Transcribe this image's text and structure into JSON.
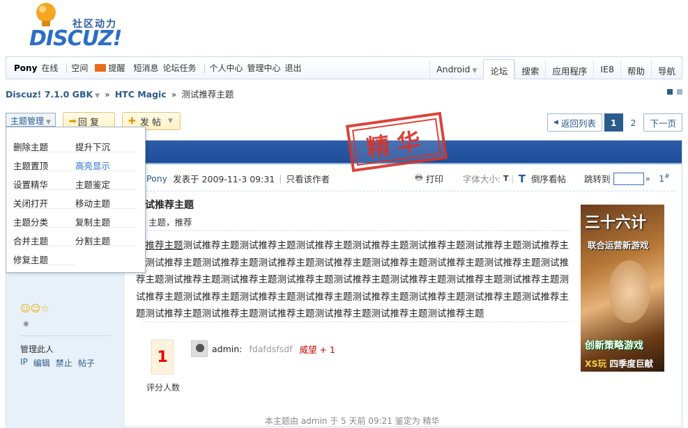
{
  "logo": {
    "cn": "社区动力",
    "en": "DISCUZ!"
  },
  "topbar": {
    "user": "Pony",
    "online": "在线",
    "left_links": [
      "空间",
      "提醒",
      "短消息",
      "论坛任务"
    ],
    "left_links2": [
      "个人中心",
      "管理中心",
      "退出"
    ],
    "right_tabs": [
      "Android",
      "论坛",
      "搜索",
      "应用程序",
      "IE8",
      "帮助",
      "导航"
    ]
  },
  "breadcrumb": {
    "home": "Discuz! 7.1.0 GBK",
    "forum": "HTC Magic",
    "sep": "»",
    "current": "测试推荐主题"
  },
  "actions": {
    "manage": "主题管理",
    "reply": "回 复",
    "post": "发 帖"
  },
  "pager": {
    "back": "返回列表",
    "pages": [
      "1",
      "2"
    ],
    "next": "下一页"
  },
  "menu": {
    "items": [
      "删除主题",
      "提升下沉",
      "主题置顶",
      "高亮显示",
      "设置精华",
      "主题鉴定",
      "关闭打开",
      "移动主题",
      "主题分类",
      "复制主题",
      "合并主题",
      "分割主题",
      "修复主题"
    ]
  },
  "stamp": {
    "text": "精华"
  },
  "post": {
    "author": "Pony",
    "posted": "发表于 2009-11-3 09:31",
    "only_author": "只看该作者",
    "print": "打印",
    "font_size_label": "字体大小:",
    "reverse": "倒序看帖",
    "jump_to": "跳转到",
    "floor": "1",
    "title": "试推荐主题",
    "tags": "主题，推荐",
    "body_prefix": "试",
    "body_link": "推荐主题",
    "body": "测试推荐主题测试推荐主题测试推荐主题测试推荐主题测试推荐主题测试推荐主题测试推荐主题测试推荐主题测试推荐主题测试推荐主题测试推荐主题测试推荐主题测试推荐主题测试推荐主题测试推荐主题测试推荐主题测试推荐主题测试推荐主题测试推荐主题测试推荐主题测试推荐主题测试推荐主题测试推荐主题测试推荐主题测试推荐主题测试推荐主题测试推荐主题测试推荐主题测试推荐主题测试推荐主题测试推荐主题测试推荐主题测试推荐主题测试推荐主题测试推荐主题测试推荐主题"
  },
  "sidebar": {
    "manage_title": "管理此人",
    "manage_links": [
      "IP",
      "编辑",
      "禁止",
      "帖子"
    ]
  },
  "ad": {
    "title": "三十六计",
    "subtitle": "联合运营新游戏",
    "slogan": "创新策略游戏",
    "footer_brand": "XS玩",
    "footer": "四季度巨献"
  },
  "rating": {
    "count": "1",
    "label": "评分人数",
    "user": "admin:",
    "reason": "fdafdsfsdf",
    "score": "威望 + 1"
  },
  "footnote": "本主题由 admin 于 5 天前 09:21 鉴定为 精华",
  "colors": {
    "link": "#2b5a8c",
    "stamp": "#d8342a",
    "header_bar": "#2c5ca8"
  }
}
